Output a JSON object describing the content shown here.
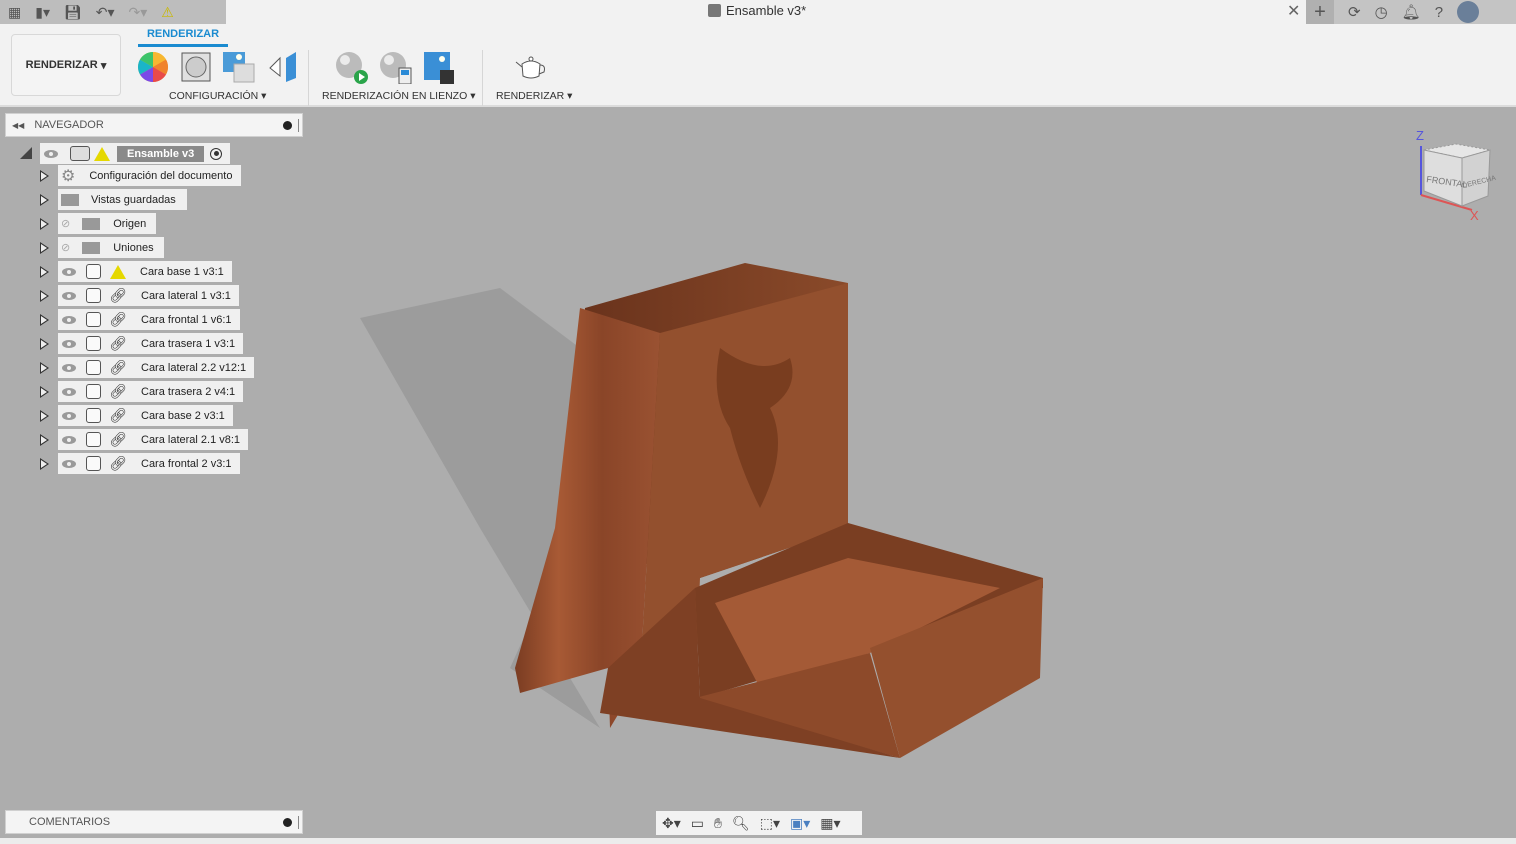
{
  "window": {
    "title": "Ensamble v3*"
  },
  "quick_access": {
    "icons": [
      "apps-grid-icon",
      "file-icon",
      "save-icon",
      "undo-icon",
      "redo-icon",
      "warning-icon"
    ]
  },
  "top_right": {
    "icons": [
      "close-tab-icon",
      "new-tab-icon",
      "extensions-icon",
      "history-icon",
      "notifications-icon",
      "help-icon",
      "user-avatar"
    ]
  },
  "toolbar": {
    "workspace": "RENDERIZAR",
    "active_tab": "RENDERIZAR",
    "groups": [
      {
        "label": "CONFIGURACIÓN",
        "icons": [
          "appearance-icon",
          "scene-settings-icon",
          "texture-map-icon",
          "decal-icon"
        ]
      },
      {
        "label": "RENDERIZACIÓN EN LIENZO",
        "icons": [
          "in-canvas-render-icon",
          "in-canvas-render-settings-icon",
          "capture-image-icon"
        ]
      },
      {
        "label": "RENDERIZAR",
        "icons": [
          "render-teapot-icon"
        ]
      }
    ]
  },
  "navigator": {
    "title": "NAVEGADOR",
    "root": "Ensamble v3",
    "items": [
      {
        "label": "Configuración del documento",
        "type": "settings"
      },
      {
        "label": "Vistas guardadas",
        "type": "folder"
      },
      {
        "label": "Origen",
        "type": "folder",
        "hidden": true
      },
      {
        "label": "Uniones",
        "type": "folder",
        "hidden": true
      },
      {
        "label": "Cara base 1 v3:1",
        "type": "component",
        "warning": true
      },
      {
        "label": "Cara lateral 1 v3:1",
        "type": "component"
      },
      {
        "label": "Cara frontal 1 v6:1",
        "type": "component"
      },
      {
        "label": "Cara trasera 1 v3:1",
        "type": "component"
      },
      {
        "label": "Cara lateral 2.2 v12:1",
        "type": "component"
      },
      {
        "label": "Cara trasera 2 v4:1",
        "type": "component"
      },
      {
        "label": "Cara base 2 v3:1",
        "type": "component"
      },
      {
        "label": "Cara lateral 2.1 v8:1",
        "type": "component"
      },
      {
        "label": "Cara frontal 2 v3:1",
        "type": "component"
      }
    ]
  },
  "viewcube": {
    "front": "FRONTAL",
    "right": "DERECHA",
    "axis_z": "Z",
    "axis_x": "X"
  },
  "comments": {
    "title": "COMENTARIOS"
  },
  "nav_toolbar": {
    "icons": [
      "orbit-icon",
      "look-at-icon",
      "pan-icon",
      "zoom-icon",
      "fit-icon",
      "display-settings-icon",
      "grid-icon"
    ]
  },
  "colors": {
    "accent": "#1a8bd0",
    "viewport": "#adadad",
    "wood": "#8a4a2a"
  }
}
